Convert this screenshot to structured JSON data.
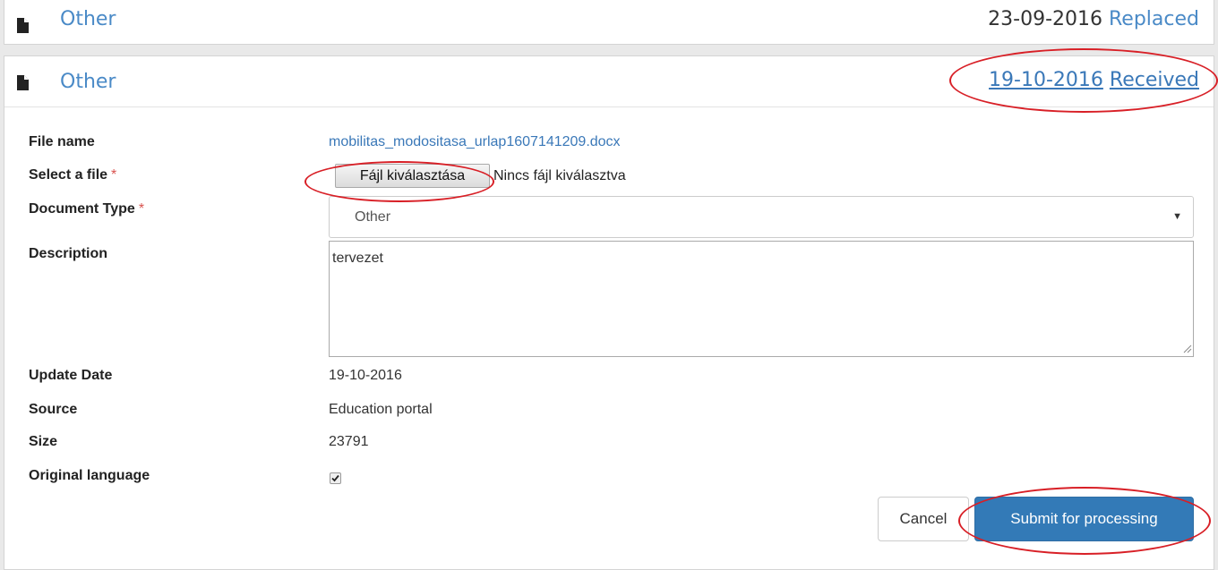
{
  "panels": [
    {
      "icon": "document-icon",
      "title": "Other",
      "date": "23-09-2016",
      "status": "Replaced"
    },
    {
      "icon": "document-icon",
      "title": "Other",
      "date": "19-10-2016",
      "status": "Received"
    }
  ],
  "form": {
    "file_name_label": "File name",
    "file_name_value": "mobilitas_modositasa_urlap1607141209.docx",
    "select_file_label": "Select a file",
    "required_mark": "*",
    "choose_file_button": "Fájl kiválasztása",
    "no_file_chosen": "Nincs fájl kiválasztva",
    "document_type_label": "Document Type",
    "document_type_value": "Other",
    "description_label": "Description",
    "description_value": "tervezet",
    "update_date_label": "Update Date",
    "update_date_value": "19-10-2016",
    "source_label": "Source",
    "source_value": "Education portal",
    "size_label": "Size",
    "size_value": "23791",
    "original_language_label": "Original language",
    "original_language_checked": true,
    "cancel_label": "Cancel",
    "submit_label": "Submit for processing"
  },
  "colors": {
    "link": "#4a8ac7",
    "primary": "#337ab7",
    "annotation": "#d81f26",
    "required": "#d9534f"
  },
  "icons": {
    "document": "document-icon",
    "caret": "caret-down-icon",
    "checkmark": "checkmark-icon",
    "resize": "resize-handle-icon"
  }
}
